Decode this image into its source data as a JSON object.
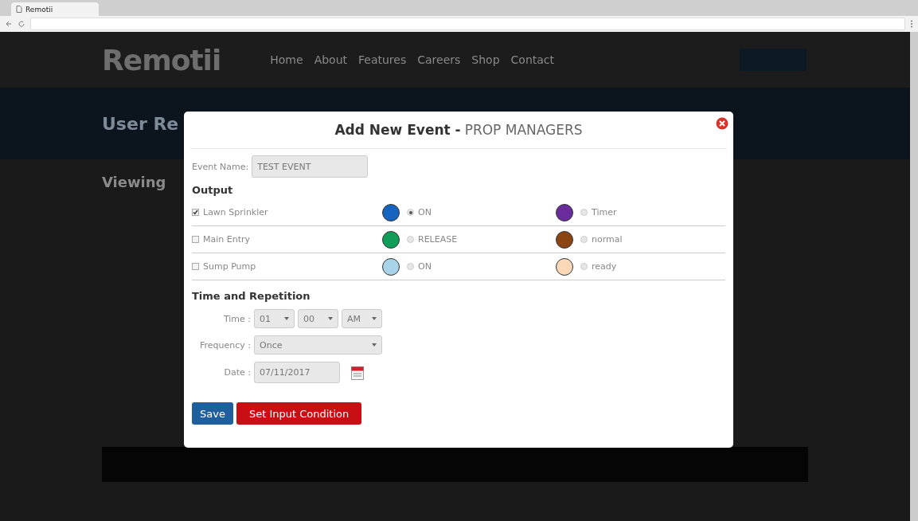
{
  "browser": {
    "tab_title": "Remotii"
  },
  "site": {
    "logo": "Remotii",
    "nav": [
      "Home",
      "About",
      "Features",
      "Careers",
      "Shop",
      "Contact"
    ],
    "banner_title": "User Re",
    "section_title": "Viewing"
  },
  "modal": {
    "title": "Add New Event -",
    "subtitle": "PROP MANAGERS",
    "event_name": {
      "label": "Event Name:",
      "value": "TEST EVENT"
    },
    "output_heading": "Output",
    "outputs": [
      {
        "name": "Lawn Sprinkler",
        "checked": true,
        "primary": {
          "color": "#1565c0",
          "label": "ON",
          "selected": true
        },
        "secondary": {
          "color": "#6a2c9a",
          "label": "Timer",
          "selected": false
        }
      },
      {
        "name": "Main Entry",
        "checked": false,
        "primary": {
          "color": "#0f9d58",
          "label": "RELEASE",
          "selected": false
        },
        "secondary": {
          "color": "#8b4513",
          "label": "normal",
          "selected": false
        }
      },
      {
        "name": "Sump Pump",
        "checked": false,
        "primary": {
          "color": "#a8d3e8",
          "label": "ON",
          "selected": false
        },
        "secondary": {
          "color": "#fbd9b8",
          "label": "ready",
          "selected": false
        }
      }
    ],
    "time_heading": "Time and Repetition",
    "time": {
      "label": "Time :",
      "hour": "01",
      "minute": "00",
      "ampm": "AM"
    },
    "frequency": {
      "label": "Frequency :",
      "value": "Once"
    },
    "date": {
      "label": "Date :",
      "value": "07/11/2017"
    },
    "buttons": [
      {
        "kind": "primary",
        "label": "Save"
      },
      {
        "kind": "danger",
        "label": "Set Input Condition"
      }
    ]
  }
}
